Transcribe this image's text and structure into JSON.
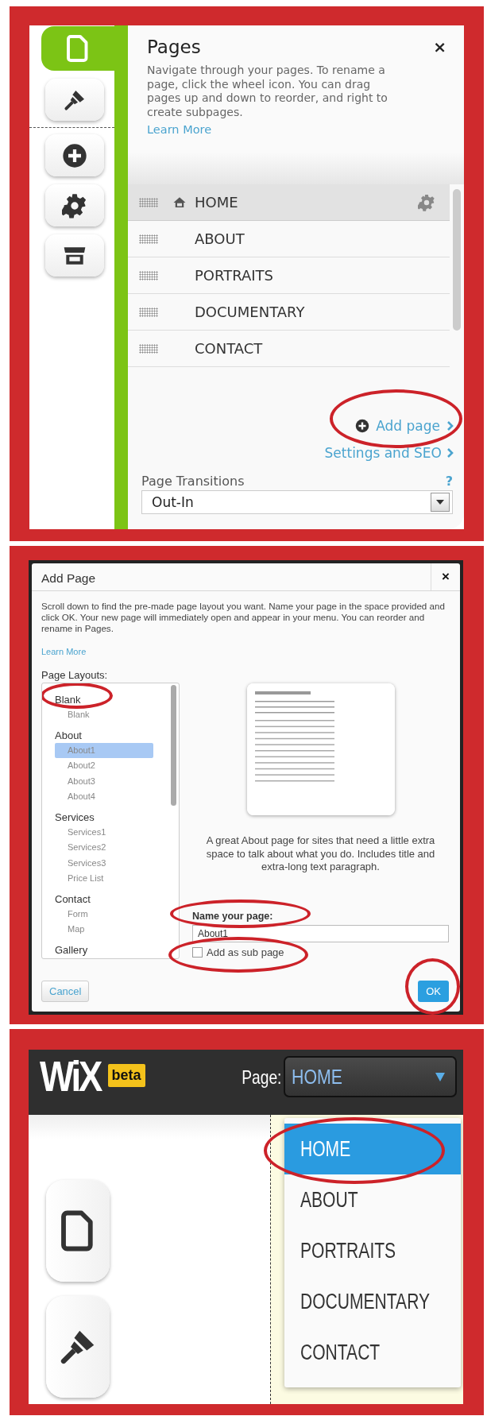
{
  "pages_panel": {
    "tool_tabs": [
      {
        "kind": "pages",
        "selected": true
      },
      {
        "kind": "design",
        "selected": false
      },
      {
        "kind": "add",
        "selected": false
      },
      {
        "kind": "settings",
        "selected": false
      },
      {
        "kind": "store",
        "selected": false
      }
    ],
    "title": "Pages",
    "close": "×",
    "description": "Navigate through your pages. To rename a page, click the wheel icon. You can drag pages up and down to reorder, and right to create subpages.",
    "learn_more": "Learn More",
    "pages": [
      {
        "name": "HOME",
        "home": true,
        "selected": true
      },
      {
        "name": "ABOUT",
        "home": false,
        "selected": false
      },
      {
        "name": "PORTRAITS",
        "home": false,
        "selected": false
      },
      {
        "name": "DOCUMENTARY",
        "home": false,
        "selected": false
      },
      {
        "name": "CONTACT",
        "home": false,
        "selected": false
      }
    ],
    "add_page": {
      "label": "Add page",
      "highlighted": true
    },
    "settings_link": "Settings and SEO",
    "transitions": {
      "label": "Page Transitions",
      "help": "?",
      "value": "Out-In"
    }
  },
  "add_page_dialog": {
    "title": "Add Page",
    "close": "×",
    "description": "Scroll down to find the pre-made page layout you want. Name your page in the space provided and click OK. Your new page will immediately open and appear in your menu. You can reorder and rename in Pages.",
    "learn_more": "Learn More",
    "layouts_label": "Page Layouts:",
    "layouts": [
      {
        "name": "Blank",
        "highlighted": true,
        "children": [
          {
            "name": "Blank",
            "selected": false
          }
        ]
      },
      {
        "name": "About",
        "highlighted": false,
        "children": [
          {
            "name": "About1",
            "selected": true
          },
          {
            "name": "About2",
            "selected": false
          },
          {
            "name": "About3",
            "selected": false
          },
          {
            "name": "About4",
            "selected": false
          }
        ]
      },
      {
        "name": "Services",
        "highlighted": false,
        "children": [
          {
            "name": "Services1",
            "selected": false
          },
          {
            "name": "Services2",
            "selected": false
          },
          {
            "name": "Services3",
            "selected": false
          },
          {
            "name": "Price List",
            "selected": false
          }
        ]
      },
      {
        "name": "Contact",
        "highlighted": false,
        "children": [
          {
            "name": "Form",
            "selected": false
          },
          {
            "name": "Map",
            "selected": false
          }
        ]
      },
      {
        "name": "Gallery",
        "highlighted": false
      }
    ],
    "preview_description": "A great About page for sites that need a little extra space to talk about what you do. Includes title and extra-long text paragraph.",
    "name_field": {
      "label": "Name your page:",
      "value": "About1",
      "highlighted": true
    },
    "subpage": {
      "label": "Add as sub page",
      "checked": false,
      "highlighted": true
    },
    "cancel": {
      "label": "Cancel"
    },
    "ok": {
      "label": "OK",
      "highlighted": true
    }
  },
  "editor": {
    "logo": "WiX",
    "badge": "beta",
    "page_label": "Page:",
    "page_value": "HOME",
    "dropdown": [
      {
        "label": "HOME",
        "selected": true,
        "highlighted": true
      },
      {
        "label": "ABOUT",
        "selected": false,
        "highlighted": false
      },
      {
        "label": "PORTRAITS",
        "selected": false,
        "highlighted": false
      },
      {
        "label": "DOCUMENTARY",
        "selected": false,
        "highlighted": false
      },
      {
        "label": "CONTACT",
        "selected": false,
        "highlighted": false
      }
    ],
    "tool_buttons": [
      {
        "kind": "pages"
      },
      {
        "kind": "design"
      }
    ]
  }
}
